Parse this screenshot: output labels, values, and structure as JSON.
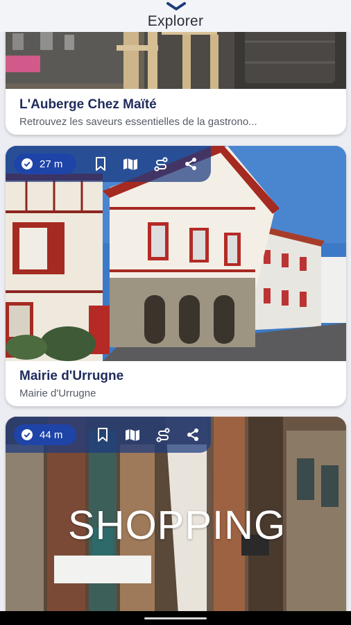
{
  "header": {
    "title": "Explorer"
  },
  "cards": [
    {
      "title": "L'Auberge Chez Maïté",
      "subtitle": "Retrouvez les saveurs essentielles de la gastrono..."
    },
    {
      "distance": "27 m",
      "title": "Mairie d'Urrugne",
      "subtitle": "Mairie d'Urrugne",
      "actions": [
        "bookmark-icon",
        "map-icon",
        "route-icon",
        "share-icon"
      ]
    },
    {
      "distance": "44 m",
      "overlay_text": "SHOPPING",
      "actions": [
        "bookmark-icon",
        "map-icon",
        "route-icon",
        "share-icon"
      ]
    }
  ],
  "colors": {
    "toolbar_overlay": "#1c3a80",
    "distance_pill": "#1f44a8",
    "title_text": "#1f2b5c"
  }
}
